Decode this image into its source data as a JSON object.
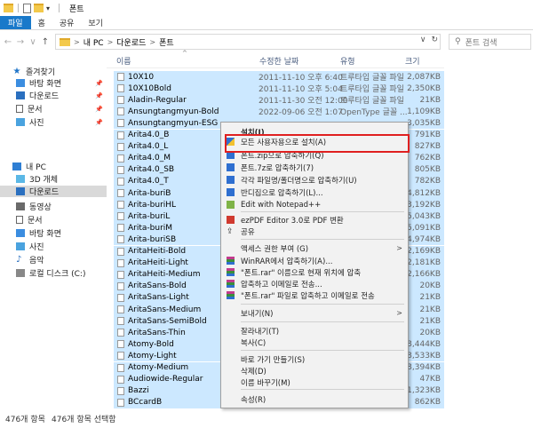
{
  "window": {
    "title": "폰트",
    "qat_arrow": "▾"
  },
  "ribbon": {
    "tabs": [
      "파일",
      "홈",
      "공유",
      "보기"
    ]
  },
  "nav": {
    "back": "←",
    "forward": "→",
    "recent": "∨",
    "up": "↑"
  },
  "address": {
    "path": [
      "내 PC",
      "다운로드",
      "폰트"
    ],
    "sep": ">",
    "dropdown": "∨",
    "refresh": "↻"
  },
  "search": {
    "placeholder": "폰트 검색",
    "icon": "⚲"
  },
  "sidebar": {
    "items": [
      {
        "label": "즐겨찾기",
        "icon": "star-icon"
      },
      {
        "label": "바탕 화면",
        "icon": "desktop-icon"
      },
      {
        "label": "다운로드",
        "icon": "download-icon"
      },
      {
        "label": "문서",
        "icon": "document-icon"
      },
      {
        "label": "사진",
        "icon": "picture-icon"
      },
      {
        "label": "내 PC",
        "icon": "pc-icon"
      },
      {
        "label": "3D 개체",
        "icon": "3d-objects-icon"
      },
      {
        "label": "다운로드",
        "icon": "download-icon"
      },
      {
        "label": "동영상",
        "icon": "video-icon"
      },
      {
        "label": "문서",
        "icon": "document-icon"
      },
      {
        "label": "바탕 화면",
        "icon": "desktop-icon"
      },
      {
        "label": "사진",
        "icon": "picture-icon"
      },
      {
        "label": "음악",
        "icon": "music-icon"
      },
      {
        "label": "로컬 디스크 (C:)",
        "icon": "disk-icon"
      }
    ],
    "pin": "📌"
  },
  "columns": {
    "name": "이름",
    "date": "수정한 날짜",
    "type": "유형",
    "size": "크기",
    "sort_arrow": "^"
  },
  "files": [
    {
      "name": "10X10",
      "date": "2011-11-10 오후 6:40",
      "type": "트루타입 글꼴 파일",
      "size": "2,087KB"
    },
    {
      "name": "10X10Bold",
      "date": "2011-11-10 오후 5:04",
      "type": "트루타입 글꼴 파일",
      "size": "2,350KB"
    },
    {
      "name": "Aladin-Regular",
      "date": "2011-11-30 오전 12:00",
      "type": "트루타입 글꼴 파일",
      "size": "21KB"
    },
    {
      "name": "Ansungtangmyun-Bold",
      "date": "2022-09-06 오전 1:07",
      "type": "OpenType 글꼴 ...",
      "size": "1,109KB"
    },
    {
      "name": "Ansungtangmyun-ESG",
      "date": "",
      "type": "",
      "size": "3,035KB"
    },
    {
      "name": "Arita4.0_B",
      "date": "",
      "type": "",
      "size": "791KB"
    },
    {
      "name": "Arita4.0_L",
      "date": "",
      "type": "",
      "size": "827KB"
    },
    {
      "name": "Arita4.0_M",
      "date": "",
      "type": "",
      "size": "762KB"
    },
    {
      "name": "Arita4.0_SB",
      "date": "",
      "type": "",
      "size": "805KB"
    },
    {
      "name": "Arita4.0_T",
      "date": "",
      "type": "",
      "size": "782KB"
    },
    {
      "name": "Arita-buriB",
      "date": "",
      "type": "",
      "size": "4,812KB"
    },
    {
      "name": "Arita-buriHL",
      "date": "",
      "type": "",
      "size": "3,192KB"
    },
    {
      "name": "Arita-buriL",
      "date": "",
      "type": "",
      "size": "5,043KB"
    },
    {
      "name": "Arita-buriM",
      "date": "",
      "type": "",
      "size": "5,091KB"
    },
    {
      "name": "Arita-buriSB",
      "date": "",
      "type": "",
      "size": "4,974KB"
    },
    {
      "name": "AritaHeiti-Bold",
      "date": "",
      "type": "",
      "size": "2,169KB"
    },
    {
      "name": "AritaHeiti-Light",
      "date": "",
      "type": "",
      "size": "2,181KB"
    },
    {
      "name": "AritaHeiti-Medium",
      "date": "",
      "type": "",
      "size": "2,166KB"
    },
    {
      "name": "AritaSans-Bold",
      "date": "",
      "type": "",
      "size": "20KB"
    },
    {
      "name": "AritaSans-Light",
      "date": "",
      "type": "",
      "size": "21KB"
    },
    {
      "name": "AritaSans-Medium",
      "date": "",
      "type": "",
      "size": "21KB"
    },
    {
      "name": "AritaSans-SemiBold",
      "date": "",
      "type": "",
      "size": "21KB"
    },
    {
      "name": "AritaSans-Thin",
      "date": "",
      "type": "",
      "size": "20KB"
    },
    {
      "name": "Atomy-Bold",
      "date": "",
      "type": "",
      "size": "8,444KB"
    },
    {
      "name": "Atomy-Light",
      "date": "",
      "type": "",
      "size": "8,533KB"
    },
    {
      "name": "Atomy-Medium",
      "date": "",
      "type": "",
      "size": "8,394KB"
    },
    {
      "name": "Audiowide-Regular",
      "date": "",
      "type": "",
      "size": "47KB"
    },
    {
      "name": "Bazzi",
      "date": "",
      "type": "",
      "size": "1,323KB"
    },
    {
      "name": "BCcardB",
      "date": "",
      "type": "",
      "size": "862KB"
    }
  ],
  "context_menu": {
    "items": [
      {
        "label": "설치(I)",
        "icon": "",
        "submenu": false
      },
      {
        "label": "모든 사용자용으로 설치(A)",
        "icon": "shield-icon",
        "submenu": false
      },
      {
        "label": "폰트.zip으로 압축하기(Q)",
        "icon": "zip-icon",
        "submenu": false
      },
      {
        "label": "폰트.7z로 압축하기(7)",
        "icon": "zip-icon",
        "submenu": false
      },
      {
        "label": "각각 파일명/폴더명으로 압축하기(U)",
        "icon": "zip-icon",
        "submenu": false
      },
      {
        "label": "반디집으로 압축하기(L)...",
        "icon": "zip-icon",
        "submenu": false
      },
      {
        "label": "Edit with Notepad++",
        "icon": "notepad-icon",
        "submenu": false
      },
      {
        "label": "ezPDF Editor 3.0로 PDF 변환",
        "icon": "pdf-icon",
        "submenu": false
      },
      {
        "label": "공유",
        "icon": "share-icon",
        "submenu": false
      },
      {
        "label": "액세스 권한 부여 (G)",
        "icon": "",
        "submenu": true
      },
      {
        "label": "WinRAR에서 압축하기(A)...",
        "icon": "winrar-icon",
        "submenu": false
      },
      {
        "label": "\"폰트.rar\" 이름으로 현재 위치에 압축",
        "icon": "winrar-icon",
        "submenu": false
      },
      {
        "label": "압축하고 이메일로 전송...",
        "icon": "winrar-icon",
        "submenu": false
      },
      {
        "label": "\"폰트.rar\" 파일로 압축하고 이메일로 전송",
        "icon": "winrar-icon",
        "submenu": false
      },
      {
        "label": "보내기(N)",
        "icon": "",
        "submenu": true
      },
      {
        "label": "잘라내기(T)",
        "icon": "",
        "submenu": false
      },
      {
        "label": "복사(C)",
        "icon": "",
        "submenu": false
      },
      {
        "label": "바로 가기 만들기(S)",
        "icon": "",
        "submenu": false
      },
      {
        "label": "삭제(D)",
        "icon": "",
        "submenu": false
      },
      {
        "label": "이름 바꾸기(M)",
        "icon": "",
        "submenu": false
      },
      {
        "label": "속성(R)",
        "icon": "",
        "submenu": false
      }
    ],
    "submenu_glyph": ">",
    "share_glyph": "⇪"
  },
  "status": {
    "count": "476개 항목",
    "selected": "476개 항목 선택함"
  },
  "colors": {
    "accent": "#1979ca",
    "selection": "#cce8ff",
    "highlight": "#e02020"
  }
}
